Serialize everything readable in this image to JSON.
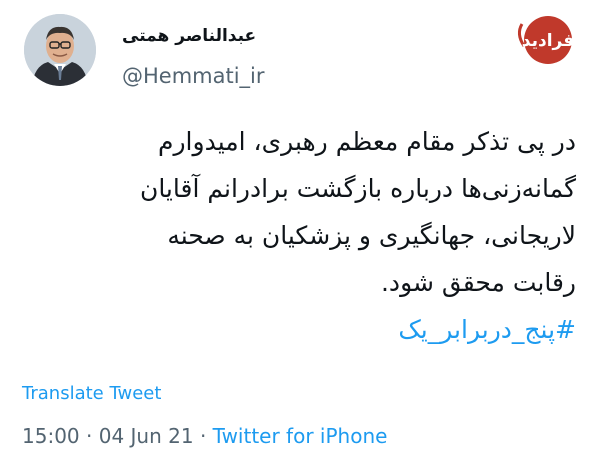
{
  "author": {
    "name": "عبدالناصر همتی",
    "handle": "@Hemmati_ir"
  },
  "logo": {
    "text": "فرادید",
    "color": "#c0392b"
  },
  "tweet": {
    "lines": [
      "در پی تذکر مقام معظم رهبری، امیدوارم",
      "گمانه‌زنی‌ها درباره بازگشت برادرانم آقایان",
      "لاریجانی، جهانگیری و پزشکیان به صحنه",
      "رقابت محقق شود."
    ],
    "hashtag": "#پنج_دربرابر_یک"
  },
  "translate_label": "Translate Tweet",
  "meta": {
    "time": "15:00",
    "date": "04 Jun 21",
    "separator": "·",
    "source": "Twitter for iPhone"
  },
  "colors": {
    "link": "#1d9bf0",
    "secondary_text": "#536471",
    "primary_text": "#0f1419"
  }
}
